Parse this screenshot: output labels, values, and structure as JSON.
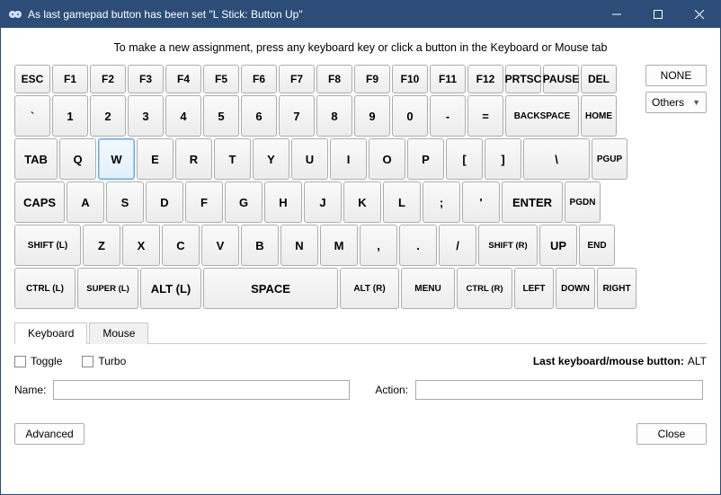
{
  "window": {
    "title": "As last gamepad button has been set \"L Stick: Button Up\""
  },
  "instruction": "To make a new assignment, press any keyboard key or click a button in the Keyboard or Mouse tab",
  "side": {
    "none_label": "NONE",
    "others_label": "Others"
  },
  "keyboard": {
    "selected_key": "W",
    "rows": [
      {
        "keys": [
          {
            "label": "ESC",
            "w": 40
          },
          {
            "label": "F1",
            "w": 40
          },
          {
            "label": "F2",
            "w": 40
          },
          {
            "label": "F3",
            "w": 40
          },
          {
            "label": "F4",
            "w": 40
          },
          {
            "label": "F5",
            "w": 40
          },
          {
            "label": "F6",
            "w": 40
          },
          {
            "label": "F7",
            "w": 40
          },
          {
            "label": "F8",
            "w": 40
          },
          {
            "label": "F9",
            "w": 40
          },
          {
            "label": "F10",
            "w": 40
          },
          {
            "label": "F11",
            "w": 40
          },
          {
            "label": "F12",
            "w": 40
          },
          {
            "label": "PRTSC",
            "w": 40,
            "cls": "tiny-text"
          },
          {
            "label": "PAUSE",
            "w": 40,
            "cls": "tiny-text"
          },
          {
            "label": "DEL",
            "w": 40
          }
        ]
      },
      {
        "keys": [
          {
            "label": "`",
            "w": 40
          },
          {
            "label": "1",
            "w": 40
          },
          {
            "label": "2",
            "w": 40
          },
          {
            "label": "3",
            "w": 40
          },
          {
            "label": "4",
            "w": 40
          },
          {
            "label": "5",
            "w": 40
          },
          {
            "label": "6",
            "w": 40
          },
          {
            "label": "7",
            "w": 40
          },
          {
            "label": "8",
            "w": 40
          },
          {
            "label": "9",
            "w": 40
          },
          {
            "label": "0",
            "w": 40
          },
          {
            "label": "-",
            "w": 40
          },
          {
            "label": "=",
            "w": 40
          },
          {
            "label": "BACKSPACE",
            "w": 82,
            "cls": "small-text"
          },
          {
            "label": "HOME",
            "w": 40,
            "cls": "small-text"
          }
        ]
      },
      {
        "keys": [
          {
            "label": "TAB",
            "w": 48
          },
          {
            "label": "Q",
            "w": 41
          },
          {
            "label": "W",
            "w": 41
          },
          {
            "label": "E",
            "w": 41
          },
          {
            "label": "R",
            "w": 41
          },
          {
            "label": "T",
            "w": 41
          },
          {
            "label": "Y",
            "w": 41
          },
          {
            "label": "U",
            "w": 41
          },
          {
            "label": "I",
            "w": 41
          },
          {
            "label": "O",
            "w": 41
          },
          {
            "label": "P",
            "w": 41
          },
          {
            "label": "[",
            "w": 41
          },
          {
            "label": "]",
            "w": 41
          },
          {
            "label": "\\",
            "w": 74
          },
          {
            "label": "PGUP",
            "w": 40,
            "cls": "small-text"
          }
        ]
      },
      {
        "keys": [
          {
            "label": "CAPS",
            "w": 56
          },
          {
            "label": "A",
            "w": 42
          },
          {
            "label": "S",
            "w": 42
          },
          {
            "label": "D",
            "w": 42
          },
          {
            "label": "F",
            "w": 42
          },
          {
            "label": "G",
            "w": 42
          },
          {
            "label": "H",
            "w": 42
          },
          {
            "label": "J",
            "w": 42
          },
          {
            "label": "K",
            "w": 42
          },
          {
            "label": "L",
            "w": 42
          },
          {
            "label": ";",
            "w": 42
          },
          {
            "label": "'",
            "w": 42
          },
          {
            "label": "ENTER",
            "w": 68
          },
          {
            "label": "PGDN",
            "w": 40,
            "cls": "small-text"
          }
        ]
      },
      {
        "keys": [
          {
            "label": "SHIFT (L)",
            "w": 74,
            "cls": "small-text"
          },
          {
            "label": "Z",
            "w": 42
          },
          {
            "label": "X",
            "w": 42
          },
          {
            "label": "C",
            "w": 42
          },
          {
            "label": "V",
            "w": 42
          },
          {
            "label": "B",
            "w": 42
          },
          {
            "label": "N",
            "w": 42
          },
          {
            "label": "M",
            "w": 42
          },
          {
            "label": ",",
            "w": 42
          },
          {
            "label": ".",
            "w": 42
          },
          {
            "label": "/",
            "w": 42
          },
          {
            "label": "SHIFT (R)",
            "w": 66,
            "cls": "tiny-text"
          },
          {
            "label": "UP",
            "w": 42
          },
          {
            "label": "END",
            "w": 40,
            "cls": "small-text"
          }
        ]
      },
      {
        "keys": [
          {
            "label": "CTRL (L)",
            "w": 68,
            "cls": "small-text"
          },
          {
            "label": "SUPER (L)",
            "w": 68,
            "cls": "tiny-text"
          },
          {
            "label": "ALT (L)",
            "w": 68
          },
          {
            "label": "SPACE",
            "w": 150
          },
          {
            "label": "ALT (R)",
            "w": 66,
            "cls": "small-text"
          },
          {
            "label": "MENU",
            "w": 60,
            "cls": "small-text"
          },
          {
            "label": "CTRL (R)",
            "w": 62,
            "cls": "tiny-text"
          },
          {
            "label": "LEFT",
            "w": 44,
            "cls": "small-text"
          },
          {
            "label": "DOWN",
            "w": 44,
            "cls": "small-text"
          },
          {
            "label": "RIGHT",
            "w": 44,
            "cls": "small-text"
          }
        ]
      }
    ]
  },
  "tabs": {
    "keyboard": "Keyboard",
    "mouse": "Mouse",
    "active": "keyboard"
  },
  "options": {
    "toggle_label": "Toggle",
    "turbo_label": "Turbo",
    "last_label": "Last keyboard/mouse button:",
    "last_value": "ALT"
  },
  "fields": {
    "name_label": "Name:",
    "name_value": "",
    "action_label": "Action:",
    "action_value": ""
  },
  "footer": {
    "advanced": "Advanced",
    "close": "Close"
  }
}
